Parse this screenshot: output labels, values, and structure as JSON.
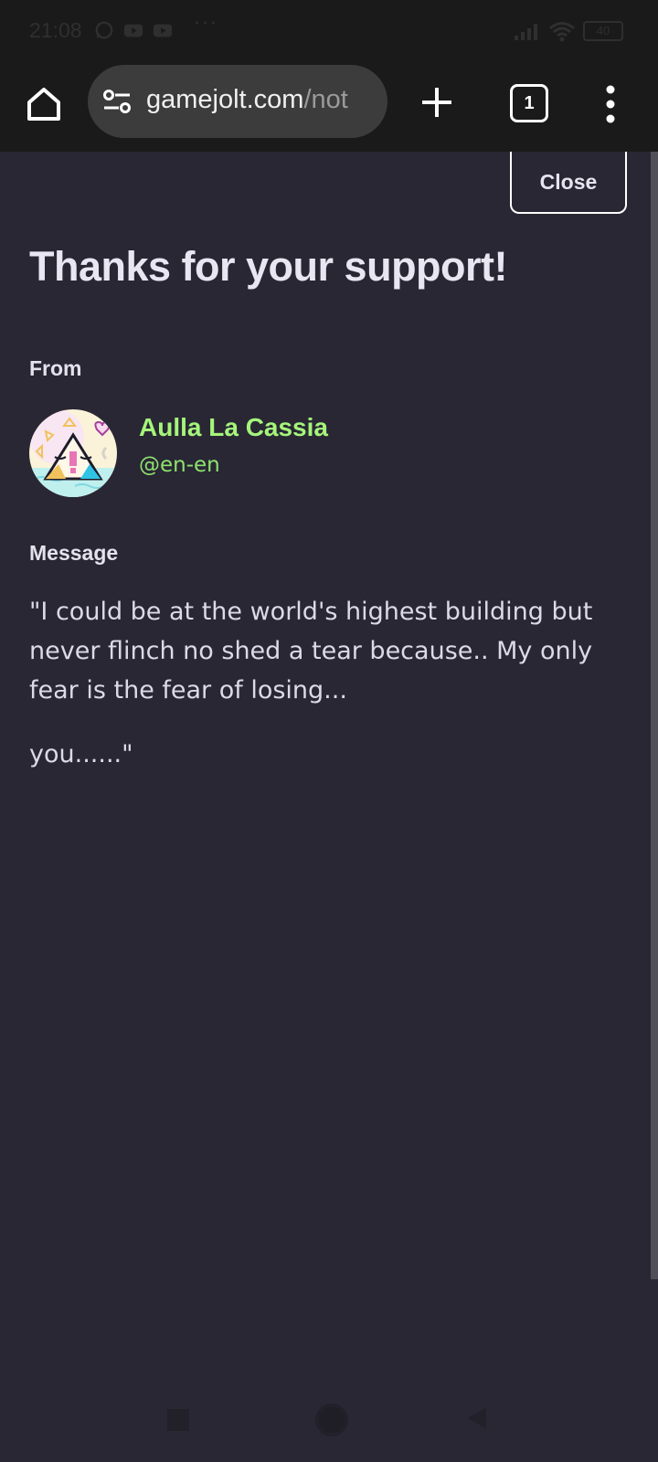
{
  "status_bar": {
    "time": "21:08",
    "battery": "40",
    "more": "···"
  },
  "browser": {
    "url_host": "gamejolt.com",
    "url_path": "/not",
    "tab_count": "1"
  },
  "page": {
    "close_label": "Close",
    "title": "Thanks for your support!",
    "from_label": "From",
    "user": {
      "name": "Aulla La Cassia",
      "handle": "@en-en"
    },
    "message_label": "Message",
    "message_paragraphs": [
      "\"I could be at the world's highest building but never flinch no shed a tear because.. My only fear is the fear of losing...",
      "you......\""
    ]
  },
  "colors": {
    "background": "#292734",
    "accent_green": "#a5f57b",
    "text": "#e8e6f1"
  }
}
